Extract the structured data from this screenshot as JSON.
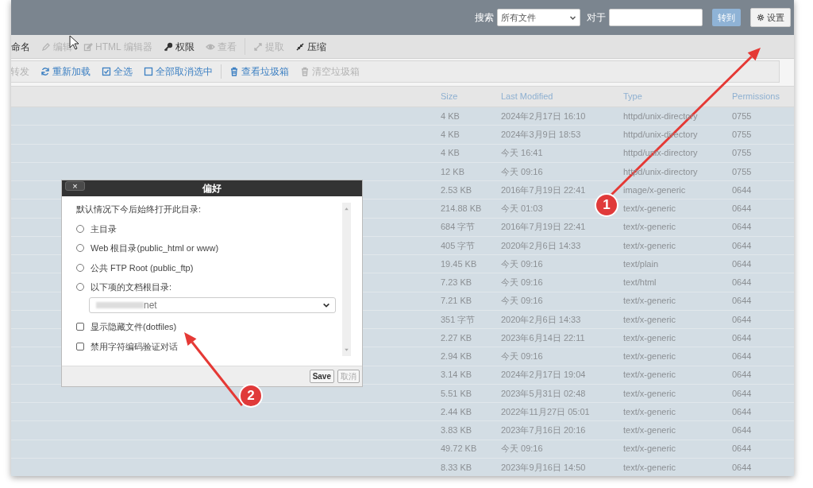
{
  "top_bar": {
    "search_label": "搜索",
    "scope": "所有文件",
    "for_label": "对于",
    "go_button": "转到",
    "settings_button": "设置"
  },
  "toolbar": [
    [
      {
        "label": "命名",
        "disabled": false
      },
      {
        "label": "编辑",
        "disabled": true
      },
      {
        "label": "HTML 编辑器",
        "disabled": true
      },
      {
        "label": "权限",
        "disabled": false
      },
      {
        "label": "查看",
        "disabled": true
      }
    ],
    [
      {
        "label": "提取",
        "disabled": true
      },
      {
        "label": "压缩",
        "disabled": false
      }
    ]
  ],
  "actions": [
    [
      {
        "label": "转发",
        "disabled": true
      },
      {
        "label": "重新加载",
        "disabled": false
      },
      {
        "label": "全选",
        "disabled": false
      },
      {
        "label": "全部取消选中",
        "disabled": false
      }
    ],
    [
      {
        "label": "查看垃圾箱",
        "disabled": false
      },
      {
        "label": "清空垃圾箱",
        "disabled": true
      }
    ]
  ],
  "table": {
    "columns": [
      "Size",
      "Last Modified",
      "Type",
      "Permissions"
    ],
    "rows": [
      {
        "size": "4 KB",
        "modified": "2024年2月17日 16:10",
        "type": "httpd/unix-directory",
        "permissions": "0755",
        "selected": true
      },
      {
        "size": "4 KB",
        "modified": "2024年3月9日 18:53",
        "type": "httpd/unix-directory",
        "permissions": "0755",
        "selected": true
      },
      {
        "size": "4 KB",
        "modified": "今天 16:41",
        "type": "httpd/unix-directory",
        "permissions": "0755",
        "selected": true
      },
      {
        "size": "12 KB",
        "modified": "今天 09:16",
        "type": "httpd/unix-directory",
        "permissions": "0755",
        "selected": true
      },
      {
        "size": "2.53 KB",
        "modified": "2016年7月19日 22:41",
        "type": "image/x-generic",
        "permissions": "0644",
        "selected": true
      },
      {
        "size": "214.88 KB",
        "modified": "今天 01:03",
        "type": "text/x-generic",
        "permissions": "0644",
        "selected": true
      },
      {
        "size": "684 字节",
        "modified": "2016年7月19日 22:41",
        "type": "text/x-generic",
        "permissions": "0644",
        "selected": true
      },
      {
        "size": "405 字节",
        "modified": "2020年2月6日 14:33",
        "type": "text/x-generic",
        "permissions": "0644",
        "selected": true
      },
      {
        "size": "19.45 KB",
        "modified": "今天 09:16",
        "type": "text/plain",
        "permissions": "0644",
        "selected": true
      },
      {
        "size": "7.23 KB",
        "modified": "今天 09:16",
        "type": "text/html",
        "permissions": "0644",
        "selected": true
      },
      {
        "size": "7.21 KB",
        "modified": "今天 09:16",
        "type": "text/x-generic",
        "permissions": "0644",
        "selected": true
      },
      {
        "size": "351 字节",
        "modified": "2020年2月6日 14:33",
        "type": "text/x-generic",
        "permissions": "0644",
        "selected": true
      },
      {
        "size": "2.27 KB",
        "modified": "2023年6月14日 22:11",
        "type": "text/x-generic",
        "permissions": "0644",
        "selected": true
      },
      {
        "size": "2.94 KB",
        "modified": "今天 09:16",
        "type": "text/x-generic",
        "permissions": "0644",
        "selected": true
      },
      {
        "size": "3.14 KB",
        "modified": "2024年2月17日 19:04",
        "type": "text/x-generic",
        "permissions": "0644",
        "selected": true
      },
      {
        "size": "5.51 KB",
        "modified": "2023年5月31日 02:48",
        "type": "text/x-generic",
        "permissions": "0644",
        "selected": true
      },
      {
        "size": "2.44 KB",
        "modified": "2022年11月27日 05:01",
        "type": "text/x-generic",
        "permissions": "0644",
        "selected": true
      },
      {
        "size": "3.83 KB",
        "modified": "2023年7月16日 20:16",
        "type": "text/x-generic",
        "permissions": "0644",
        "selected": true
      },
      {
        "size": "49.72 KB",
        "modified": "今天 09:16",
        "type": "text/x-generic",
        "permissions": "0644",
        "selected": true
      },
      {
        "size": "8.33 KB",
        "modified": "2023年9月16日 14:50",
        "type": "text/x-generic",
        "permissions": "0644",
        "selected": true
      }
    ]
  },
  "dialog": {
    "title": "偏好",
    "close": "×",
    "prompt": "默认情况下今后始终打开此目录:",
    "radios": [
      {
        "label": "主目录",
        "selected": false
      },
      {
        "label": "Web 根目录(public_html or www)",
        "selected": false
      },
      {
        "label": "公共 FTP Root (public_ftp)",
        "selected": false
      },
      {
        "label": "以下项的文档根目录:",
        "selected": false
      }
    ],
    "docroot_value": "net",
    "checkboxes": [
      {
        "label": "显示隐藏文件(dotfiles)",
        "checked": false
      },
      {
        "label": "禁用字符编码验证对话",
        "checked": false
      }
    ],
    "buttons": [
      {
        "label": "Save",
        "disabled": false
      },
      {
        "label": "取消",
        "disabled": true
      }
    ]
  },
  "annotations": [
    {
      "label": "1"
    },
    {
      "label": "2"
    }
  ]
}
